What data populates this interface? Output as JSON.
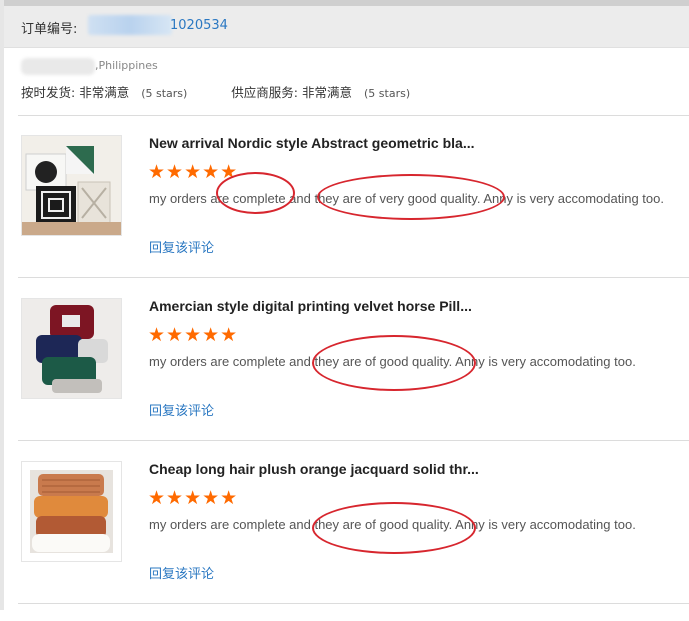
{
  "order": {
    "label": "订单编号:",
    "number_suffix": "1020534"
  },
  "buyer": {
    "address_suffix": ",Philippines",
    "ratings": [
      {
        "label": "按时发货:",
        "value": "非常满意",
        "stars_note": "(5 stars)"
      },
      {
        "label": "供应商服务:",
        "value": "非常满意",
        "stars_note": "(5 stars)"
      }
    ]
  },
  "reviews": [
    {
      "title": "New arrival Nordic style Abstract geometric bla...",
      "stars": "★★★★★",
      "rating": 5,
      "text": "my orders are complete and they are of very good quality. Anny is very accomodating too.",
      "reply_label": "回复该评论"
    },
    {
      "title": "Amercian style digital printing velvet horse Pill...",
      "stars": "★★★★★",
      "rating": 5,
      "text": "my orders are complete and they are of good quality. Anny is very accomodating too.",
      "reply_label": "回复该评论"
    },
    {
      "title": "Cheap long hair plush orange jacquard solid thr...",
      "stars": "★★★★★",
      "rating": 5,
      "text": "my orders are complete and they are of good quality. Anny is very accomodating too.",
      "reply_label": "回复该评论"
    }
  ],
  "colors": {
    "star": "#ff6a00",
    "link": "#2b78c2",
    "annotation": "#d7262e"
  }
}
